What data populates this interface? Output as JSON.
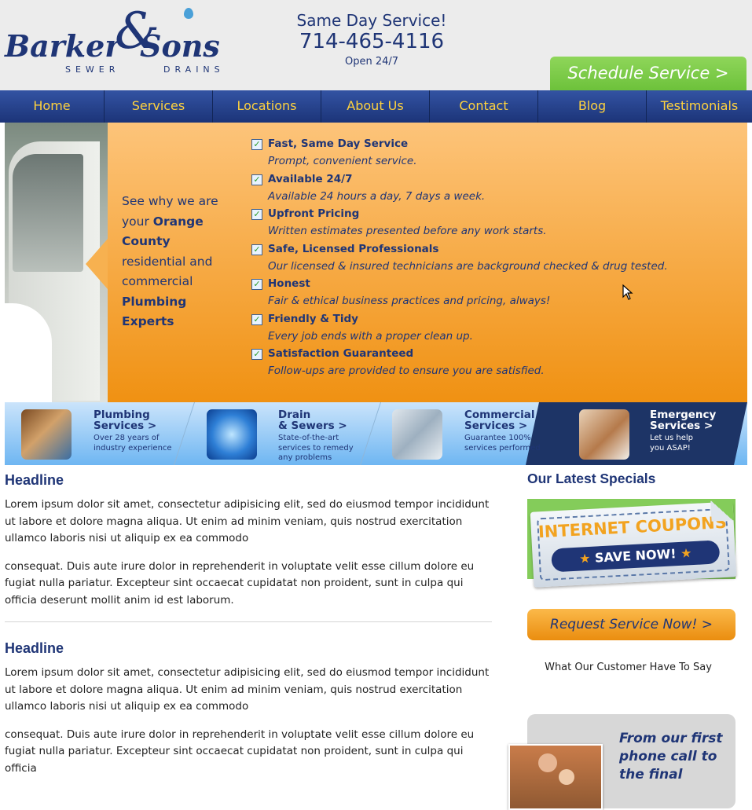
{
  "brand": {
    "name_left": "Barker",
    "name_amp": "&",
    "name_right": "Sons",
    "sub_left": "SEWER",
    "sub_right": "DRAINS"
  },
  "contact": {
    "tagline": "Same Day Service!",
    "phone": "714-465-4116",
    "hours": "Open 24/7"
  },
  "schedule_button": "Schedule Service >",
  "nav": [
    {
      "label": "Home"
    },
    {
      "label": "Services"
    },
    {
      "label": "Locations"
    },
    {
      "label": "About Us"
    },
    {
      "label": "Contact"
    },
    {
      "label": "Blog"
    },
    {
      "label": "Testimonials"
    }
  ],
  "hero": {
    "intro_1": "See why we are your",
    "intro_bold": "Orange County",
    "intro_2": "residential and commercial",
    "intro_bold_2": "Plumbing Experts",
    "features": [
      {
        "title": "Fast, Same Day Service",
        "desc": "Prompt, convenient service."
      },
      {
        "title": "Available 24/7",
        "desc": "Available 24 hours a day, 7 days a week."
      },
      {
        "title": "Upfront Pricing",
        "desc": "Written estimates presented before any work starts."
      },
      {
        "title": "Safe, Licensed Professionals",
        "desc": "Our licensed & insured technicians are background checked & drug tested."
      },
      {
        "title": "Honest",
        "desc": "Fair & ethical business practices and pricing, always!"
      },
      {
        "title": "Friendly & Tidy",
        "desc": "Every job ends with a proper clean up."
      },
      {
        "title": "Satisfaction Guaranteed",
        "desc": "Follow-ups are provided to ensure you are satisfied."
      }
    ]
  },
  "services": [
    {
      "title_1": "Plumbing",
      "title_2": "Services >",
      "desc_1": "Over 28 years of",
      "desc_2": "industry experience",
      "desc_3": ""
    },
    {
      "title_1": "Drain",
      "title_2": "& Sewers >",
      "desc_1": "State-of-the-art",
      "desc_2": "services to remedy",
      "desc_3": "any problems"
    },
    {
      "title_1": "Commercial",
      "title_2": "Services >",
      "desc_1": "Guarantee 100%",
      "desc_2": "services performed",
      "desc_3": ""
    },
    {
      "title_1": "Emergency",
      "title_2": "Services >",
      "desc_1": "Let us help",
      "desc_2": "you ASAP!",
      "desc_3": ""
    }
  ],
  "articles": [
    {
      "headline": "Headline",
      "p1": "Lorem ipsum dolor sit amet, consectetur adipisicing elit, sed do eiusmod tempor incididunt ut labore et dolore magna aliqua. Ut enim ad minim veniam, quis nostrud exercitation ullamco laboris nisi ut aliquip ex ea commodo",
      "p2": "consequat. Duis aute irure dolor in reprehenderit in voluptate velit esse cillum dolore eu fugiat nulla pariatur. Excepteur sint occaecat cupidatat non proident, sunt in culpa qui officia deserunt mollit anim id est laborum."
    },
    {
      "headline": "Headline",
      "p1": "Lorem ipsum dolor sit amet, consectetur adipisicing elit, sed do eiusmod tempor incididunt ut labore et dolore magna aliqua. Ut enim ad minim veniam, quis nostrud exercitation ullamco laboris nisi ut aliquip ex ea commodo",
      "p2": "consequat. Duis aute irure dolor in reprehenderit in voluptate velit esse cillum dolore eu fugiat nulla pariatur. Excepteur sint occaecat cupidatat non proident, sunt in culpa qui officia"
    }
  ],
  "sidebar": {
    "specials_title": "Our Latest Specials",
    "coupon_top": "INTERNET COUPONS",
    "coupon_cta": "SAVE NOW!",
    "request_button": "Request Service Now! >",
    "testimonial_heading": "What Our Customer Have To Say",
    "testimonial_quote": "From our first phone call to the final"
  },
  "colors": {
    "navy": "#1f3576",
    "nav_text": "#ffd23e",
    "orange": "#f09112",
    "green": "#6cc13a"
  }
}
